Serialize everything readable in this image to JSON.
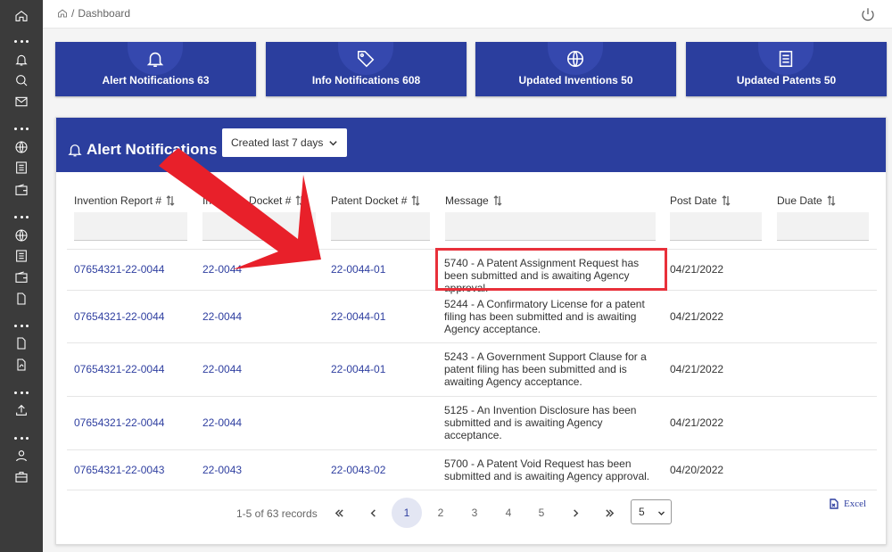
{
  "breadcrumb": {
    "separator": "/",
    "current": "Dashboard"
  },
  "stats": [
    {
      "label": "Alert Notifications 63",
      "icon": "bell-icon"
    },
    {
      "label": "Info Notifications 608",
      "icon": "tag-icon"
    },
    {
      "label": "Updated Inventions 50",
      "icon": "globe-icon"
    },
    {
      "label": "Updated Patents 50",
      "icon": "document-icon"
    }
  ],
  "panel": {
    "title": "Alert Notifications",
    "filter": "Created last 7 days"
  },
  "table": {
    "headers": [
      "Invention Report #",
      "Invention Docket #",
      "Patent Docket #",
      "Message",
      "Post Date",
      "Due Date"
    ],
    "rows": [
      {
        "report": "07654321-22-0044",
        "invention_docket": "22-0044",
        "patent_docket": "22-0044-01",
        "message": "5740 - A Patent Assignment Request has been submitted and is awaiting Agency approval.",
        "post_date": "04/21/2022",
        "due_date": ""
      },
      {
        "report": "07654321-22-0044",
        "invention_docket": "22-0044",
        "patent_docket": "22-0044-01",
        "message": "5244 - A Confirmatory License for a patent filing has been submitted and is awaiting Agency acceptance.",
        "post_date": "04/21/2022",
        "due_date": ""
      },
      {
        "report": "07654321-22-0044",
        "invention_docket": "22-0044",
        "patent_docket": "22-0044-01",
        "message": "5243 - A Government Support Clause for a patent filing has been submitted and is awaiting Agency acceptance.",
        "post_date": "04/21/2022",
        "due_date": ""
      },
      {
        "report": "07654321-22-0044",
        "invention_docket": "22-0044",
        "patent_docket": "",
        "message": "5125 - An Invention Disclosure has been submitted and is awaiting Agency acceptance.",
        "post_date": "04/21/2022",
        "due_date": ""
      },
      {
        "report": "07654321-22-0043",
        "invention_docket": "22-0043",
        "patent_docket": "22-0043-02",
        "message": "5700 - A Patent Void Request has been submitted and is awaiting Agency approval.",
        "post_date": "04/20/2022",
        "due_date": ""
      }
    ]
  },
  "pagination": {
    "records": "1-5 of 63 records",
    "pages": [
      "1",
      "2",
      "3",
      "4",
      "5"
    ],
    "active": "1",
    "page_size": "5",
    "export": "Excel"
  },
  "colors": {
    "brand": "#2b3e9e",
    "link": "#2f3fa0",
    "highlight": "#e8303a"
  }
}
